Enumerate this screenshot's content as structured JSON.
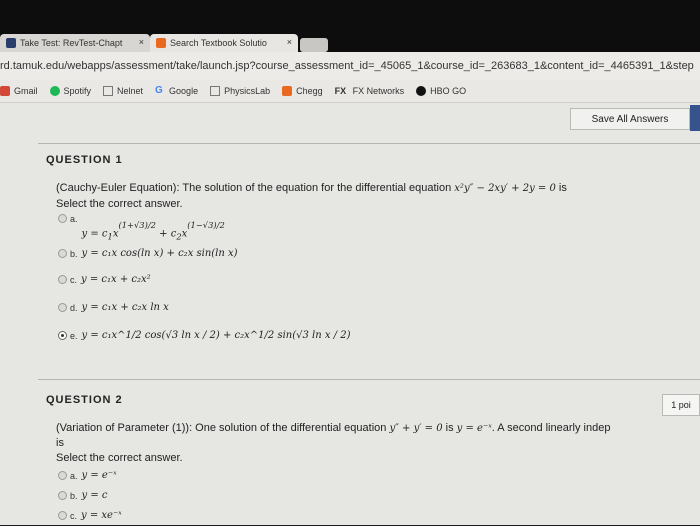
{
  "browser": {
    "tabs": [
      {
        "label": "Take Test: RevTest-Chapt",
        "close": "×"
      },
      {
        "label": "Search Textbook Solutio",
        "close": "×"
      }
    ],
    "url": "rd.tamuk.edu/webapps/assessment/take/launch.jsp?course_assessment_id=_45065_1&course_id=_263683_1&content_id=_4465391_1&step",
    "bookmarks": [
      "Gmail",
      "Spotify",
      "Nelnet",
      "Google",
      "PhysicsLab",
      "Chegg",
      "FX Networks",
      "HBO GO"
    ]
  },
  "toolbar": {
    "save_all_label": "Save All Answers"
  },
  "questions": [
    {
      "heading": "QUESTION 1",
      "prompt_prefix": "(Cauchy-Euler Equation): The solution of the equation for the differential equation ",
      "prompt_math": "x²y″ − 2xy′ + 2y = 0",
      "prompt_suffix": " is",
      "instruction": "Select the correct answer.",
      "options": [
        {
          "letter": "a.",
          "text": "y = c₁x^((1+√3)/2) + c₂x^((1−√3)/2)",
          "exp1": "(1+√3)/2",
          "exp2": "(1−√3)/2",
          "selected": false
        },
        {
          "letter": "b.",
          "text": "y = c₁x cos(ln x) + c₂x sin(ln x)",
          "selected": false
        },
        {
          "letter": "c.",
          "text": "y = c₁x + c₂x²",
          "selected": false
        },
        {
          "letter": "d.",
          "text": "y = c₁x + c₂x ln x",
          "selected": false
        },
        {
          "letter": "e.",
          "text": "y = c₁x^1/2 cos(√3 ln x / 2) + c₂x^1/2 sin(√3 ln x / 2)",
          "selected": true
        }
      ]
    },
    {
      "heading": "QUESTION 2",
      "points": "1 poi",
      "prompt_prefix": "(Variation of Parameter (1)): One solution of the differential equation ",
      "prompt_math": "y″ + y′ = 0",
      "prompt_mid": " is ",
      "prompt_math2": "y = e⁻ˣ",
      "prompt_suffix": ". A second linearly indep",
      "prompt_line2": "is",
      "instruction": "Select the correct answer.",
      "options": [
        {
          "letter": "a.",
          "text": "y = e⁻ˣ",
          "selected": false
        },
        {
          "letter": "b.",
          "text": "y = c",
          "selected": false
        },
        {
          "letter": "c.",
          "text": "y = xe⁻ˣ",
          "selected": false
        }
      ]
    }
  ]
}
